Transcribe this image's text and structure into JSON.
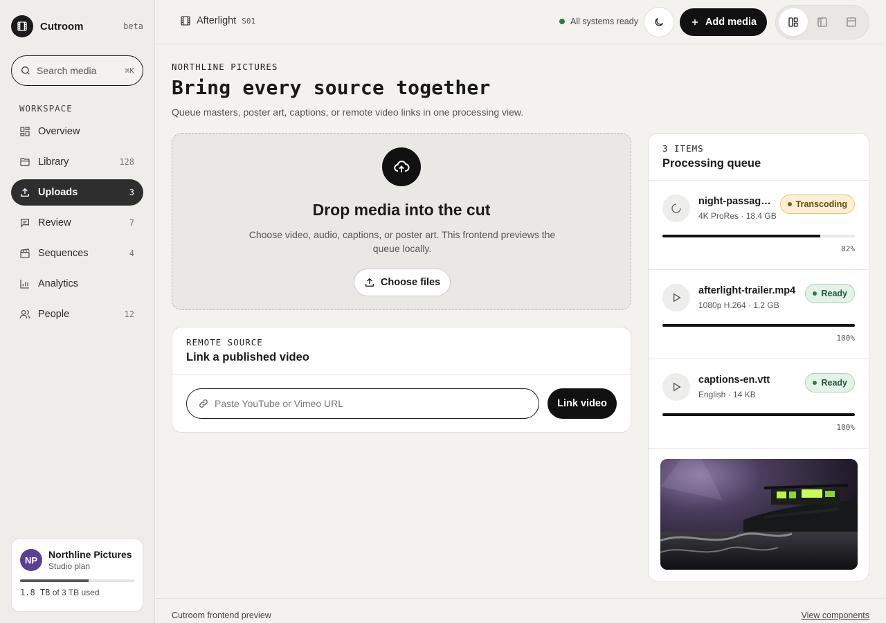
{
  "brand": {
    "name": "Cutroom",
    "badge": "beta"
  },
  "search": {
    "placeholder": "Search media",
    "shortcut": "⌘K"
  },
  "sidebar": {
    "section_label": "WORKSPACE",
    "items": [
      {
        "label": "Overview",
        "count": "",
        "icon": "grid-icon"
      },
      {
        "label": "Library",
        "count": "128",
        "icon": "folder-icon"
      },
      {
        "label": "Uploads",
        "count": "3",
        "icon": "upload-icon",
        "active": true
      },
      {
        "label": "Review",
        "count": "7",
        "icon": "message-icon"
      },
      {
        "label": "Sequences",
        "count": "4",
        "icon": "clapperboard-icon"
      },
      {
        "label": "Analytics",
        "count": "",
        "icon": "bar-chart-icon"
      },
      {
        "label": "People",
        "count": "12",
        "icon": "users-icon"
      }
    ]
  },
  "account": {
    "initials": "NP",
    "name": "Northline Pictures",
    "plan": "Studio plan",
    "storage_used": "1.8 TB",
    "storage_rest": " of 3 TB used",
    "storage_fraction": 0.6,
    "avatar_color": "#5b3f93"
  },
  "header": {
    "project": "Afterlight",
    "season": "S01",
    "status": "All systems ready",
    "add_label": "Add media"
  },
  "main": {
    "eyebrow": "NORTHLINE PICTURES",
    "title": "Bring every source together",
    "subtitle": "Queue masters, poster art, captions, or remote video links in one processing view."
  },
  "dropzone": {
    "title": "Drop media into the cut",
    "description": "Choose video, audio, captions, or poster art. This frontend previews the queue locally.",
    "button": "Choose files"
  },
  "remote": {
    "eyebrow": "REMOTE SOURCE",
    "title": "Link a published video",
    "placeholder": "Paste YouTube or Vimeo URL",
    "button": "Link video"
  },
  "queue": {
    "count": "3 ITEMS",
    "title": "Processing queue",
    "items": [
      {
        "name": "night-passage_master.mov",
        "meta": "4K ProRes · 18.4 GB",
        "status": "Transcoding",
        "progress": 82,
        "percent": "82%"
      },
      {
        "name": "afterlight-trailer.mp4",
        "meta": "1080p H.264 · 1.2 GB",
        "status": "Ready",
        "progress": 100,
        "percent": "100%"
      },
      {
        "name": "captions-en.vtt",
        "meta": "English · 14 KB",
        "status": "Ready",
        "progress": 100,
        "percent": "100%"
      }
    ]
  },
  "footer": {
    "left": "Cutroom frontend preview",
    "right": "View components"
  }
}
